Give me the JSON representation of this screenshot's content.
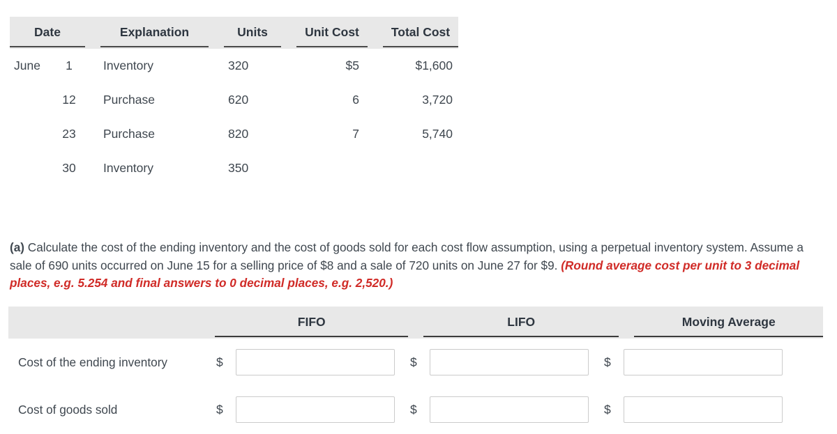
{
  "inventory_table": {
    "columns": [
      "Date",
      "Explanation",
      "Units",
      "Unit Cost",
      "Total Cost"
    ],
    "rows": [
      {
        "month": "June",
        "day": "1",
        "explanation": "Inventory",
        "units": "320",
        "unit_cost": "$5",
        "total_cost": "$1,600"
      },
      {
        "month": "",
        "day": "12",
        "explanation": "Purchase",
        "units": "620",
        "unit_cost": "6",
        "total_cost": "3,720"
      },
      {
        "month": "",
        "day": "23",
        "explanation": "Purchase",
        "units": "820",
        "unit_cost": "7",
        "total_cost": "5,740"
      },
      {
        "month": "",
        "day": "30",
        "explanation": "Inventory",
        "units": "350",
        "unit_cost": "",
        "total_cost": ""
      }
    ]
  },
  "instructions": {
    "tag": "(a)",
    "body": " Calculate the cost of the ending inventory and the cost of goods sold for each cost flow assumption, using a perpetual inventory system. Assume a sale of 690 units occurred on June 15 for a selling price of $8 and a sale of 720 units on June 27 for $9. ",
    "note": "(Round average cost per unit to 3 decimal places, e.g. 5.254 and final answers to 0 decimal places, e.g. 2,520.)",
    "note_color": "#d02b27"
  },
  "answer_table": {
    "columns": [
      "FIFO",
      "LIFO",
      "Moving Average"
    ],
    "currency_symbol": "$",
    "rows": [
      {
        "label": "Cost of the ending inventory",
        "fifo": "",
        "lifo": "",
        "moving_average": "",
        "placeholder": ""
      },
      {
        "label": "Cost of goods sold",
        "fifo": "",
        "lifo": "",
        "moving_average": "",
        "placeholder": ""
      }
    ]
  }
}
